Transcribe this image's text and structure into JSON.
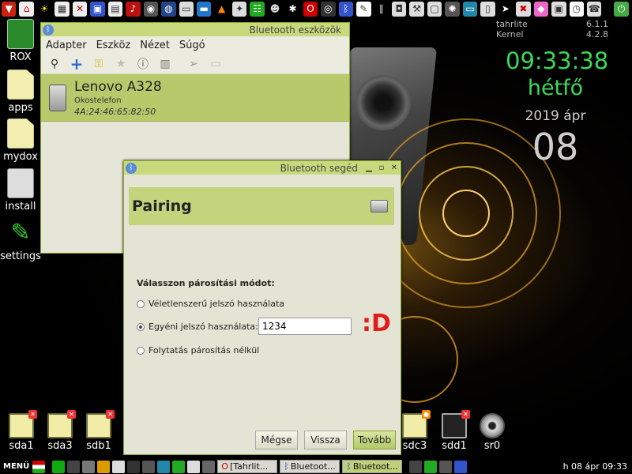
{
  "sysinfo": {
    "rows": [
      [
        "tahrlite",
        "6.1.1"
      ],
      [
        "Kernel",
        "4.2.8"
      ]
    ]
  },
  "clock": {
    "time": "09:33:38",
    "day": "hétfő",
    "date": "2019 ápr",
    "daynum": "08"
  },
  "desktop_icons": [
    {
      "label": "ROX"
    },
    {
      "label": "apps"
    },
    {
      "label": "mydox"
    },
    {
      "label": "install"
    },
    {
      "label": "settings"
    }
  ],
  "bt_manager": {
    "title": "Bluetooth eszközök",
    "menu": [
      "Adapter",
      "Eszköz",
      "Nézet",
      "Súgó"
    ],
    "device": {
      "name": "Lenovo A328",
      "type": "Okostelefon",
      "address": "4A:24:46:65:82:50"
    }
  },
  "bt_assistant": {
    "title": "Bluetooth segéd",
    "heading": "Pairing",
    "mode_label": "Válasszon párosítási módot:",
    "options": [
      "Véletlenszerű jelszó használata",
      "Egyéni jelszó használata:",
      "Folytatás párosítás nélkül"
    ],
    "selected_option": 1,
    "pin_value": "1234",
    "buttons": {
      "cancel": "Mégse",
      "back": "Vissza",
      "next": "Tovább"
    }
  },
  "annotation": ":D",
  "drives": [
    {
      "label": "sda1"
    },
    {
      "label": "sda3"
    },
    {
      "label": "sdb1"
    },
    {
      "label": "sdc3"
    },
    {
      "label": "sdd1"
    },
    {
      "label": "sr0"
    }
  ],
  "taskbar": {
    "menu_label": "MENÜ",
    "tasks": [
      "[Tahrlit...",
      "Bluetoot...",
      "Bluetoot..."
    ],
    "clock": "h 08 ápr 09:33"
  }
}
